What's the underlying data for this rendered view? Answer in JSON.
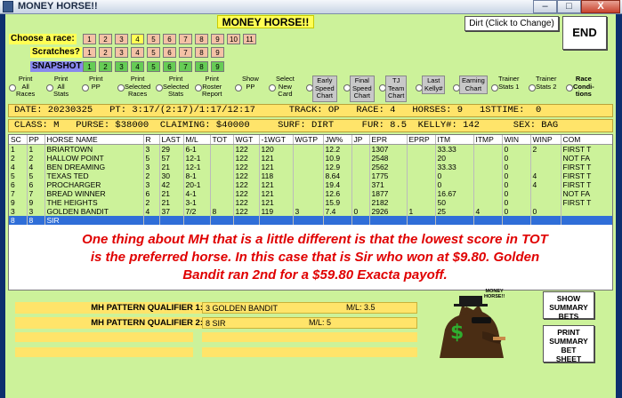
{
  "window": {
    "title": "MONEY HORSE!!",
    "minimize": "–",
    "maximize": "□",
    "close": "X"
  },
  "header": {
    "app_title": "MONEY HORSE!!",
    "dirt_button": "Dirt (Click to Change)",
    "end_button": "END"
  },
  "race_row": {
    "label": "Choose a race:",
    "numbers": [
      "1",
      "2",
      "3",
      "4",
      "5",
      "6",
      "7",
      "8",
      "9",
      "10",
      "11"
    ],
    "selected": "4"
  },
  "scratch_row": {
    "label": "Scratches?",
    "numbers": [
      "1",
      "2",
      "3",
      "4",
      "5",
      "6",
      "7",
      "8",
      "9"
    ]
  },
  "snapshot_row": {
    "label": "SNAPSHOT",
    "numbers": [
      "1",
      "2",
      "3",
      "4",
      "5",
      "6",
      "7",
      "8",
      "9"
    ]
  },
  "options": [
    {
      "label": "Print\nAll\nRaces",
      "type": "radio"
    },
    {
      "label": "Print\nAll\nStats",
      "type": "radio"
    },
    {
      "label": "Print\nPP",
      "type": "radio"
    },
    {
      "label": "Print\nSelected\nRaces",
      "type": "radio"
    },
    {
      "label": "Print\nSelected\nStats",
      "type": "radio"
    },
    {
      "label": "Print\nRoster\nReport",
      "type": "radio"
    },
    {
      "label": "Show\nPP",
      "type": "radio"
    },
    {
      "label": "Select\nNew\nCard",
      "type": "radio"
    },
    {
      "label": "Early\nSpeed\nChart",
      "type": "button"
    },
    {
      "label": "Final\nSpeed\nChart",
      "type": "button"
    },
    {
      "label": "TJ\nTeam\nChart",
      "type": "button"
    },
    {
      "label": "Last\nKelly#",
      "type": "button"
    },
    {
      "label": "Earning\nChart",
      "type": "button"
    },
    {
      "label": "Trainer\nStats 1",
      "type": "radio"
    },
    {
      "label": "Trainer\nStats 2",
      "type": "radio"
    },
    {
      "label": "Race\nCondi-\ntions",
      "type": "radio"
    }
  ],
  "info_line1": "DATE: 20230325   PT: 3:17/(2:17)/1:17/12:17      TRACK: OP   RACE: 4   HORSES: 9   1STTIME:  0",
  "info_line2": "CLASS: M   PURSE: $38000  CLAIMING: $40000     SURF: DIRT     FUR: 8.5  KELLY#: 142      SEX: BAG",
  "table": {
    "columns": [
      "SC",
      "PP",
      "HORSE NAME",
      "R",
      "LAST",
      "M/L",
      "TOT",
      "WGT",
      "-1WGT",
      "WGTP",
      "JW%",
      "JP",
      "EPR",
      "EPRP",
      "ITM",
      "ITMP",
      "WIN",
      "WINP",
      "COM"
    ],
    "rows": [
      [
        "1",
        "1",
        "BRIARTOWN",
        "3",
        "29",
        "6-1",
        "",
        "122",
        "120",
        "",
        "12.2",
        "",
        "1307",
        "",
        "33.33",
        "",
        "0",
        "2",
        "FIRST T"
      ],
      [
        "2",
        "2",
        "HALLOW POINT",
        "5",
        "57",
        "12-1",
        "",
        "122",
        "121",
        "",
        "10.9",
        "",
        "2548",
        "",
        "20",
        "",
        "0",
        "",
        "NOT FA"
      ],
      [
        "4",
        "4",
        "BEN DREAMING",
        "3",
        "21",
        "12-1",
        "",
        "122",
        "121",
        "",
        "12.9",
        "",
        "2562",
        "",
        "33.33",
        "",
        "0",
        "",
        "FIRST T"
      ],
      [
        "5",
        "5",
        "TEXAS TED",
        "2",
        "30",
        "8-1",
        "",
        "122",
        "118",
        "",
        "8.64",
        "",
        "1775",
        "",
        "0",
        "",
        "0",
        "4",
        "FIRST T"
      ],
      [
        "6",
        "6",
        "PROCHARGER",
        "3",
        "42",
        "20-1",
        "",
        "122",
        "121",
        "",
        "19.4",
        "",
        "371",
        "",
        "0",
        "",
        "0",
        "4",
        "FIRST T"
      ],
      [
        "7",
        "7",
        "BREAD WINNER",
        "6",
        "21",
        "4-1",
        "",
        "122",
        "121",
        "",
        "12.6",
        "",
        "1877",
        "",
        "16.67",
        "",
        "0",
        "",
        "NOT FA"
      ],
      [
        "9",
        "9",
        "THE HEIGHTS",
        "2",
        "21",
        "3-1",
        "",
        "122",
        "121",
        "",
        "15.9",
        "",
        "2182",
        "",
        "50",
        "",
        "0",
        "",
        "FIRST T"
      ],
      [
        "3",
        "3",
        "GOLDEN BANDIT",
        "4",
        "37",
        "7/2",
        "8",
        "122",
        "119",
        "3",
        "7.4",
        "0",
        "2926",
        "1",
        "25",
        "4",
        "0",
        "0",
        ""
      ],
      [
        "8",
        "8",
        "SIR",
        "",
        "",
        "",
        "",
        "",
        "",
        "",
        "",
        "",
        "",
        "",
        "",
        "",
        "",
        "",
        ""
      ]
    ],
    "selected_row": 8
  },
  "overlay_text": "One thing about MH that is a little different is that the lowest score in TOT is the preferred horse.  In this case that is Sir who won at $9.80.  Golden Bandit ran 2nd for a $59.80 Exacta payoff.",
  "patterns": [
    {
      "label": "MH PATTERN QUALIFIER 1:",
      "value": "3  GOLDEN BANDIT",
      "ml": "M/L:  3.5"
    },
    {
      "label": "MH PATTERN QUALIFIER 2:",
      "value": "8  SIR",
      "ml": "M/L:  5"
    }
  ],
  "logo_text": "MONEY\nHORSE!!",
  "side_buttons": {
    "show_summary": "SHOW\nSUMMARY\nBETS",
    "print_summary": "PRINT\nSUMMARY\nBET\nSHEET"
  },
  "colors": {
    "panel_green": "#ccf29a",
    "banner_yellow": "#ffe46a",
    "title_yellow": "#ffff55",
    "overlay_red": "#e00000",
    "selection_blue": "#2f6ed8"
  }
}
